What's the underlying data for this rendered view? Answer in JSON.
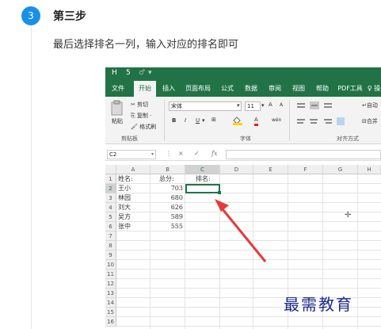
{
  "step": {
    "number": "3",
    "title": "第三步",
    "description": "最后选择排名一列，输入对应的排名即可"
  },
  "excel": {
    "quick_access": {
      "save": "H",
      "undo": "5",
      "redo": "♂"
    },
    "tabs": [
      "文件",
      "开始",
      "插入",
      "页面布局",
      "公式",
      "数据",
      "审阅",
      "视图",
      "帮助",
      "PDF工具",
      "♀ 操"
    ],
    "active_tab": "开始",
    "clipboard": {
      "paste_label": "粘贴",
      "cut_label": "剪切",
      "copy_label": "复制 ·",
      "format_painter_label": "格式刷",
      "group_label": "剪贴板"
    },
    "font": {
      "name_value": "宋体",
      "size_value": "11",
      "grow_label": "A",
      "shrink_label": "A",
      "bold_label": "B",
      "italic_label": "I",
      "underline_label": "U",
      "font_color_label": "A",
      "phonetic_label": "wén",
      "group_label": "字体"
    },
    "alignment": {
      "wrap_label": "自动",
      "merge_label": "合并",
      "group_label": "对齐方式"
    },
    "name_box": "C2",
    "formula_icons": {
      "cancel": "×",
      "enter": "✓",
      "fx": "fx"
    },
    "formula_value": "",
    "columns": [
      "A",
      "B",
      "C",
      "D",
      "E",
      "F",
      "G",
      "H"
    ],
    "rows": [
      "1",
      "2",
      "3",
      "4",
      "5",
      "6",
      "7",
      "8",
      "9",
      "10",
      "11",
      "12",
      "13",
      "14",
      "15",
      "16"
    ],
    "header_row": {
      "a": "姓名:",
      "b": "总分:",
      "c": "排名:"
    },
    "data_rows": [
      {
        "name": "王小",
        "score": "703"
      },
      {
        "name": "林园",
        "score": "680"
      },
      {
        "name": "刘大",
        "score": "626"
      },
      {
        "name": "吴方",
        "score": "589"
      },
      {
        "name": "张中",
        "score": "555"
      }
    ],
    "selected_cell": "C2",
    "colors": {
      "ribbon": "#217346",
      "arrow": "#e53b3b"
    }
  },
  "watermark": "最需教育"
}
